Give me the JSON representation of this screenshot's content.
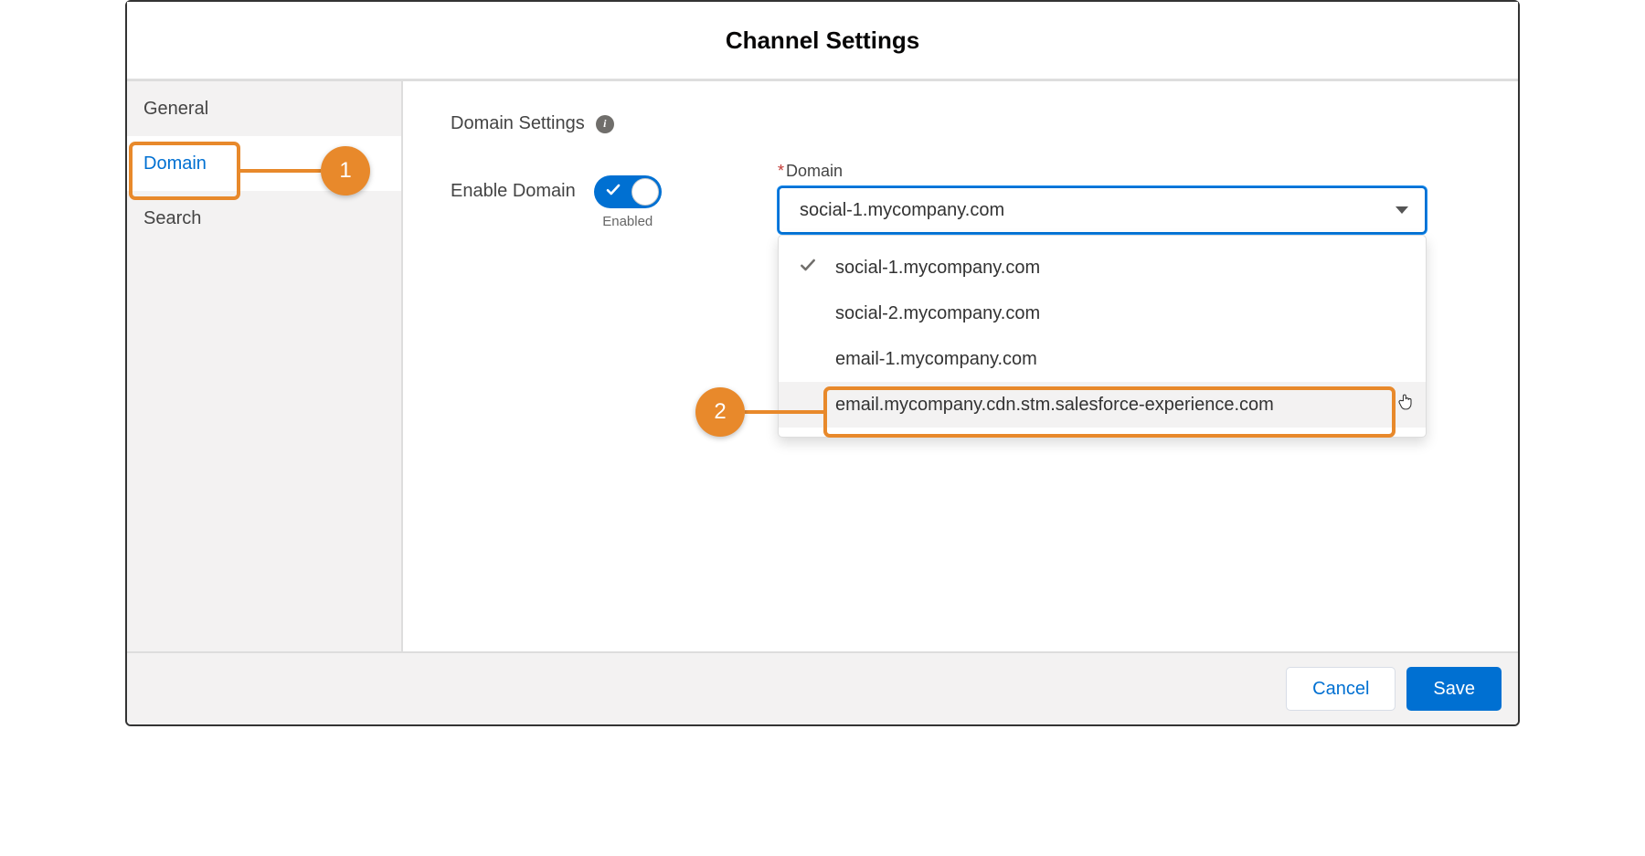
{
  "header": {
    "title": "Channel Settings"
  },
  "sidebar": {
    "items": [
      {
        "label": "General"
      },
      {
        "label": "Domain"
      },
      {
        "label": "Search"
      }
    ]
  },
  "main": {
    "section_title": "Domain Settings",
    "info_icon": "i",
    "enable_label": "Enable Domain",
    "toggle_status": "Enabled",
    "field": {
      "required": "*",
      "label": "Domain",
      "selected": "social-1.mycompany.com",
      "options": [
        "social-1.mycompany.com",
        "social-2.mycompany.com",
        "email-1.mycompany.com",
        "email.mycompany.cdn.stm.salesforce-experience.com"
      ]
    }
  },
  "footer": {
    "cancel": "Cancel",
    "save": "Save"
  },
  "annotations": {
    "marker1": "1",
    "marker2": "2"
  }
}
